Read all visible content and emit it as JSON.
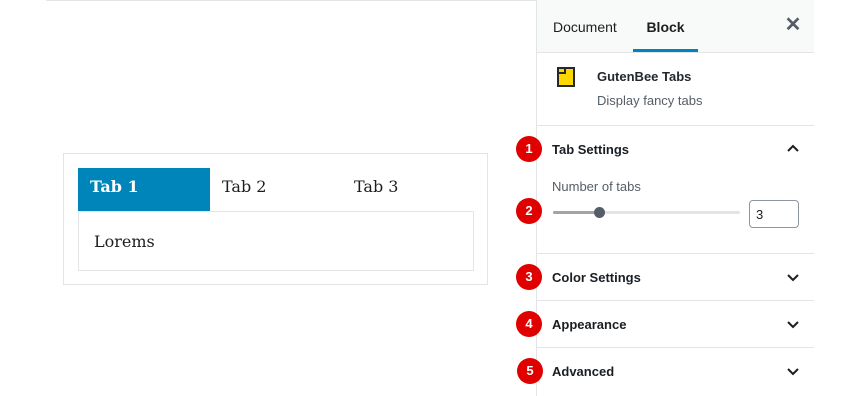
{
  "canvas": {
    "tabs": [
      {
        "label": "Tab 1",
        "active": true
      },
      {
        "label": "Tab 2",
        "active": false
      },
      {
        "label": "Tab 3",
        "active": false
      }
    ],
    "panel_text": "Lorems",
    "accent": "#0085ba"
  },
  "sidebar": {
    "tabs": {
      "document": "Document",
      "block": "Block"
    },
    "close_icon": "close-icon",
    "block": {
      "icon": "block-tabs-icon",
      "title": "GutenBee Tabs",
      "description": "Display fancy tabs"
    },
    "panels": [
      {
        "title": "Tab Settings",
        "expanded": true,
        "marker": "1"
      },
      {
        "title": "Color Settings",
        "expanded": false,
        "marker": "3"
      },
      {
        "title": "Appearance",
        "expanded": false,
        "marker": "4"
      },
      {
        "title": "Advanced",
        "expanded": false,
        "marker": "5"
      }
    ],
    "tab_settings": {
      "label": "Number of tabs",
      "value": "3",
      "slider_marker": "2"
    }
  },
  "colors": {
    "marker_red": "#e00000",
    "icon_yellow": "#ffd700"
  }
}
